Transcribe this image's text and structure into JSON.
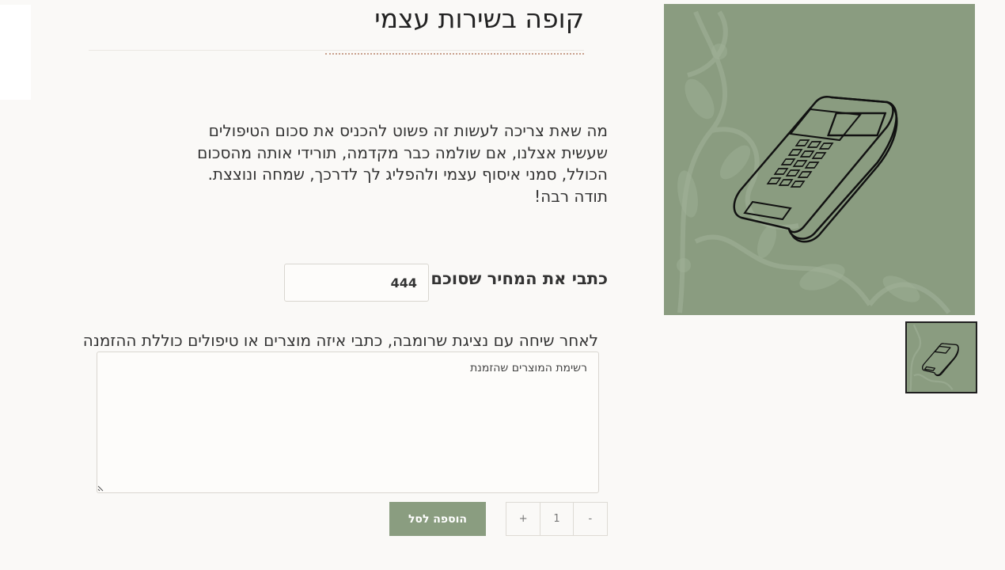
{
  "product": {
    "title": "קופה בשירות עצמי",
    "description_lines": [
      "מה שאת צריכה לעשות זה פשוט להכניס את סכום הטיפולים",
      "שעשית אצלנו, אם שולמה כבר מקדמה, תורידי אותה מהסכום",
      "הכולל, סמני איסוף עצמי ולהפליג לך לדרכך, שמחה ונוצצת.",
      "תודה רבה!"
    ]
  },
  "price_field": {
    "label": "כתבי את המחיר שסוכם ₪",
    "value": "444"
  },
  "order_field": {
    "label": "לאחר שיחה עם נציגת שרומבה, כתבי איזה מוצרים או טיפולים כוללת ההזמנה",
    "value": "רשימת המוצרים שהזמנת"
  },
  "quantity": {
    "minus": "-",
    "value": "1",
    "plus": "+"
  },
  "add_to_cart": {
    "label": "הוספה לסל"
  },
  "images": {
    "main_icon": "card-terminal-icon",
    "thumb_icon": "card-terminal-icon"
  },
  "colors": {
    "accent": "#8a9d80",
    "image_bg": "#8a9c80",
    "page_bg": "#faf9f7"
  }
}
